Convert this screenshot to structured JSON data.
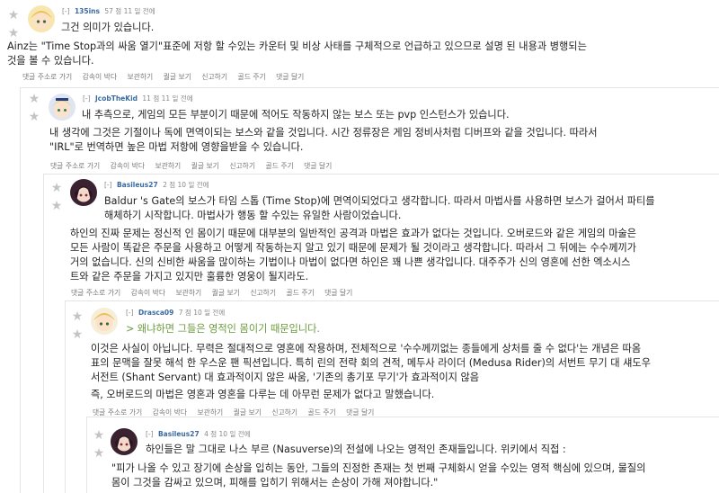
{
  "comments": [
    {
      "user": "135ins",
      "toggle": "[-]",
      "points": "57 점",
      "time": "11 일 전에",
      "lines": [
        "그건 의미가 있습니다.",
        "Ainz는 \"Time Stop과의 싸움 열기\"표준에 저항 할 수있는 카운터 및 비상 사태를 구체적으로 언급하고 있으므로 설명 된 내용과 병행되는",
        "것을 볼 수 있습니다."
      ]
    },
    {
      "user": "JcobTheKid",
      "toggle": "[-]",
      "points": "11 점",
      "time": "11 일 전에",
      "lines": [
        "내 추측으로, 게임의 모든 부분이기 때문에 적어도 작동하지 않는 보스 또는 pvp 인스턴스가 있습니다.",
        "내 생각에 그것은 기절이나 독에 면역이되는 보스와 같을 것입니다. 시간 정류장은 게임 정비사처럼 디버프와 같을 것입니다. 따라서",
        "\"IRL\"로 번역하면 높은 마법 저항에 영향을받을 수 있습니다."
      ]
    },
    {
      "user": "Basileus27",
      "toggle": "[-]",
      "points": "2 점",
      "time": "10 일 전에",
      "lines": [
        "Baldur 's Gate의 보스가 타임 스톱 (Time Stop)에 면역이되었다고 생각합니다. 따라서 마법사를 사용하면 보스가 걸어서 파티를",
        "해체하기 시작합니다. 마법사가 행동 할 수있는 유일한 사람이었습니다.",
        "하인의 진짜 문제는 정신적 인 몸이기 때문에 대부분의 일반적인 공격과 마법은 효과가 없다는 것입니다. 오버로드와 같은 게임의 마술은",
        "모든 사람이 똑같은 주문을 사용하고 어떻게 작동하는지 알고 있기 때문에 문제가 될 것이라고 생각합니다. 따라서 그 뒤에는 수수께끼가",
        "거의 없습니다. 신의 신비한 싸움을 많이하는 기법이나 마법이 없다면 하인은 꽤 나쁜 생각입니다. 대주주가 신의 영혼에 선한 엑소시스",
        "트와 같은 주문을 가지고 있지만 훌륭한 영웅이 될지라도."
      ]
    },
    {
      "user": "Drasca09",
      "toggle": "[-]",
      "points": "7 점",
      "time": "10 일 전에",
      "lines": [
        "> 왜냐하면 그들은 영적인 몸이기 때문입니다.",
        "이것은 사실이 아닙니다. 무력은 절대적으로 영혼에 작용하며, 전체적으로 '수수께끼없는 종들에게 상처를 줄 수 없다'는 개념은 따옴",
        "표의 문맥을 잘못 해석 한 우스운 팬 픽션입니다. 특히 린의 전략 회의 견적, 메두사 라이더 (Medusa Rider)의 서번트 무기 대 섀도우",
        "서전트 (Shant Servant) 대 효과적이지 않은 싸움, '기존의 총기포 무기'가 효과적이지 않음",
        "즉, 오버로드의 마법은 영혼과 영혼을 다루는 데 아무런 문제가 없다고 말했습니다."
      ]
    },
    {
      "user": "Basileus27",
      "toggle": "[-]",
      "points": "4 점",
      "time": "10 일 전에",
      "lines": [
        "하인들은 말 그대로 나스 부르 (Nasuverse)의 전설에 나오는 영적인 존재들입니다. 위키에서 직접 :",
        "\"피가 나올 수 있고 장기에 손상을 입히는 동안, 그들의 진정한 존재는 첫 번째 구체화시 얻을 수있는 영적 핵심에 있으며, 물질의",
        "몸이 그것을 감싸고 있으며, 피해를 입히기 위해서는 손상이 가해 져야합니다.\""
      ]
    }
  ],
  "actions": {
    "save": "댓글 주소로 가기",
    "unhide": "감속이 박다",
    "report": "보관하기",
    "embed": "퀄글 보기",
    "flag": "신고하기",
    "gold": "골드 주기",
    "reply": "댓글 달기"
  },
  "icons": {
    "upvote": "star-icon",
    "downvote": "star-icon"
  },
  "colors": {
    "username": "#3b6aa0",
    "quote": "#6a9a3d",
    "meta": "#888888"
  }
}
